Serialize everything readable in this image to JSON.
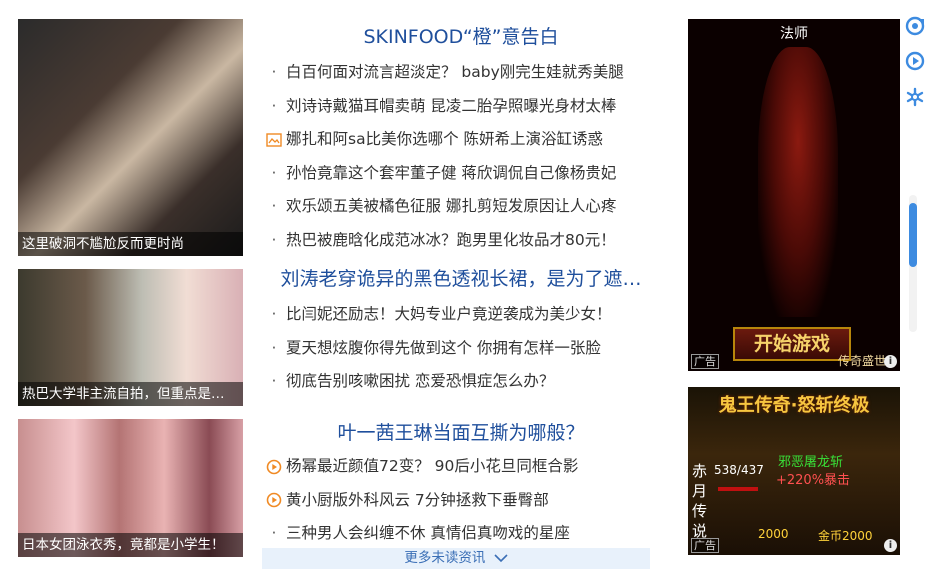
{
  "thumbs": [
    {
      "caption": "这里破洞不尴尬反而更时尚"
    },
    {
      "caption": "热巴大学非主流自拍，但重点是…"
    },
    {
      "caption": "日本女团泳衣秀，竟都是小学生！"
    }
  ],
  "sections": [
    {
      "headline": "SKINFOOD“橙”意告白",
      "items": [
        {
          "marker": "dot",
          "text": "白百何面对流言超淡定？ baby刚完生娃就秀美腿"
        },
        {
          "marker": "dot",
          "text": "刘诗诗戴猫耳帽卖萌 昆凌二胎孕照曝光身材太棒"
        },
        {
          "marker": "image",
          "text": "娜扎和阿sa比美你选哪个 陈妍希上演浴缸诱惑"
        },
        {
          "marker": "dot",
          "text": "孙怡竟靠这个套牢董子健 蒋欣调侃自己像杨贵妃"
        },
        {
          "marker": "dot",
          "text": "欢乐颂五美被橘色征服 娜扎剪短发原因让人心疼"
        },
        {
          "marker": "dot",
          "text": "热巴被鹿晗化成范冰冰？跑男里化妆品才80元！"
        }
      ]
    },
    {
      "headline": "刘涛老穿诡异的黑色透视长裙，是为了遮…",
      "items": [
        {
          "marker": "dot",
          "text": "比闫妮还励志！大妈专业户竟逆袭成为美少女！"
        },
        {
          "marker": "dot",
          "text": "夏天想炫腹你得先做到这个 你拥有怎样一张脸"
        },
        {
          "marker": "dot",
          "text": "彻底告别咳嗽困扰 恋爱恐惧症怎么办？"
        }
      ]
    },
    {
      "headline": "叶一茜王琳当面互撕为哪般？",
      "items": [
        {
          "marker": "video",
          "text": "杨幂最近颜值72变？ 90后小花旦同框合影"
        },
        {
          "marker": "video",
          "text": "黄小厨版外科风云 7分钟拯救下垂臀部"
        },
        {
          "marker": "dot",
          "text": "三种男人会纠缠不休 真情侣真吻戏的星座"
        }
      ]
    }
  ],
  "more": {
    "label": "更多未读资讯"
  },
  "ads": {
    "ad1": {
      "title": "法师",
      "button": "开始游戏",
      "tag": "广告",
      "brand": "传奇盛世"
    },
    "ad2": {
      "title": "鬼王传奇·怒斩终极",
      "side": "赤月传说",
      "stat": "538/437",
      "sub": "邪恶屠龙斩",
      "sub2": "+220%暴击",
      "gold_label": "金币2000",
      "gold_left": "2000",
      "tag": "广告"
    }
  },
  "colors": {
    "headline": "#1f4f9c",
    "accent": "#3d8be0",
    "more_bg": "#e8f1fb",
    "video_marker": "#f08a24"
  }
}
